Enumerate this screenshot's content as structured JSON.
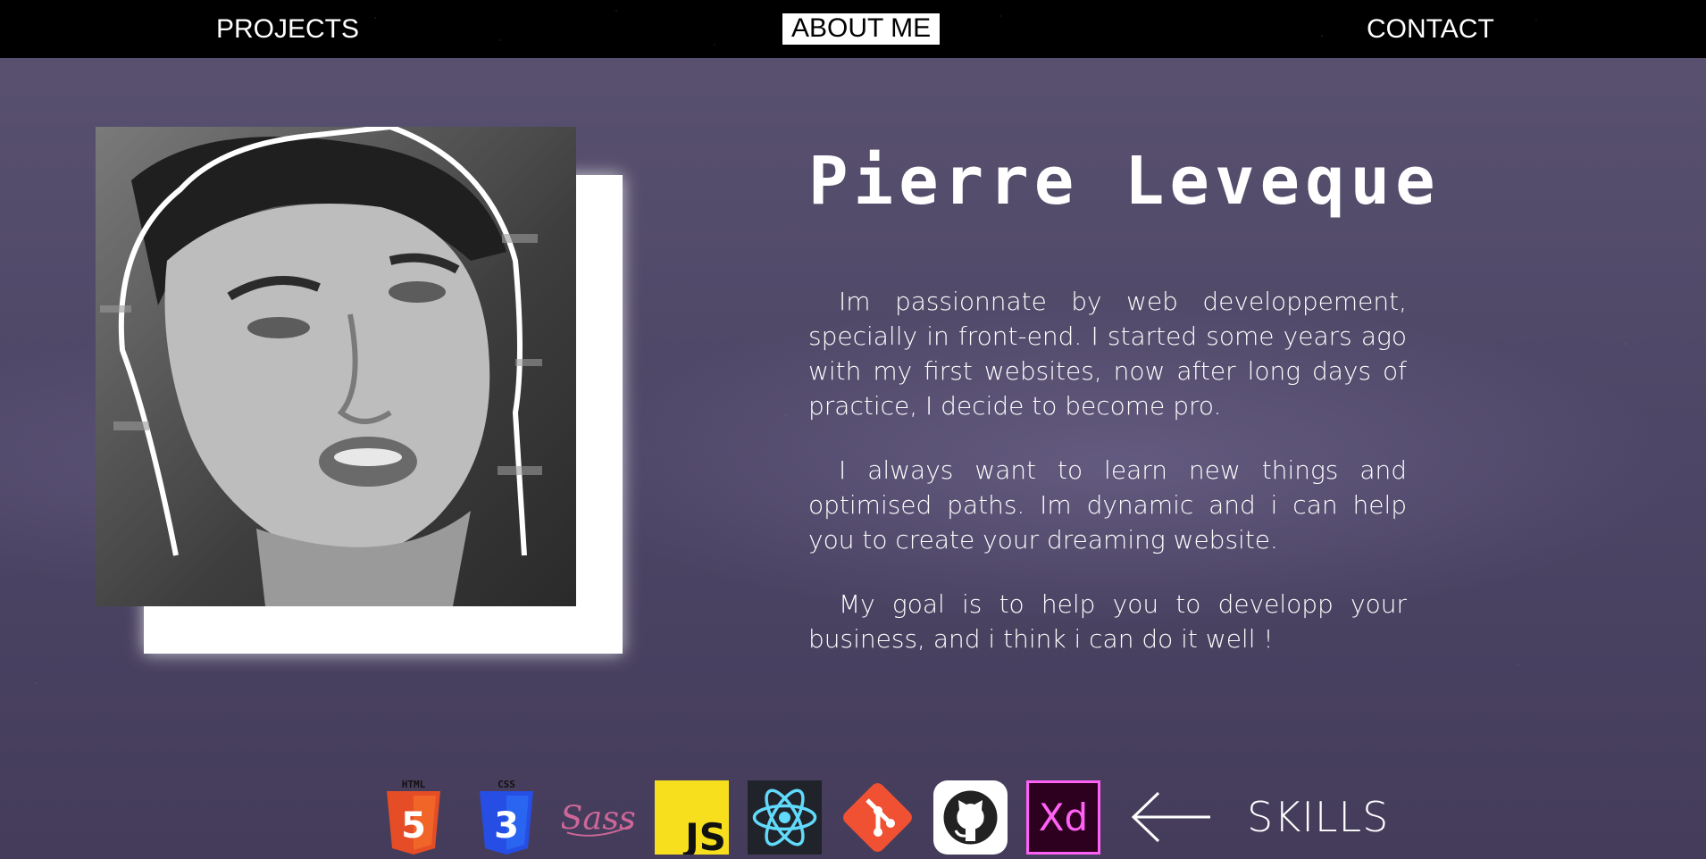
{
  "nav": {
    "projects": "PROJECTS",
    "about": "ABOUT ME",
    "contact": "CONTACT"
  },
  "profile": {
    "name": "Pierre Leveque",
    "paragraphs": [
      "Im passionnate by web developpement, specially in front-end. I started some years ago with my first websites, now after long days of practice, I decide to become pro.",
      "I always want to learn new things and optimised paths. Im dynamic and i can help you to create your dreaming website.",
      "My goal is to help you to developp your business, and i think i can do it well !"
    ]
  },
  "skills": {
    "label": "SKILLS",
    "items": [
      {
        "icon": "html5-icon",
        "caption": "HTML",
        "badge": "5"
      },
      {
        "icon": "css3-icon",
        "caption": "CSS",
        "badge": "3"
      },
      {
        "icon": "sass-icon",
        "text": "Sass"
      },
      {
        "icon": "javascript-icon",
        "text": "JS"
      },
      {
        "icon": "react-icon"
      },
      {
        "icon": "git-icon"
      },
      {
        "icon": "github-icon"
      },
      {
        "icon": "adobe-xd-icon",
        "text": "Xd"
      }
    ]
  },
  "colors": {
    "background": "#4d4565",
    "navbar": "#000000",
    "html5": "#e44d26",
    "css3": "#264de4",
    "sass": "#cd6799",
    "javascript": "#f7df1e",
    "react": "#61dafb",
    "git": "#f05133",
    "xd": "#ff61f6"
  }
}
